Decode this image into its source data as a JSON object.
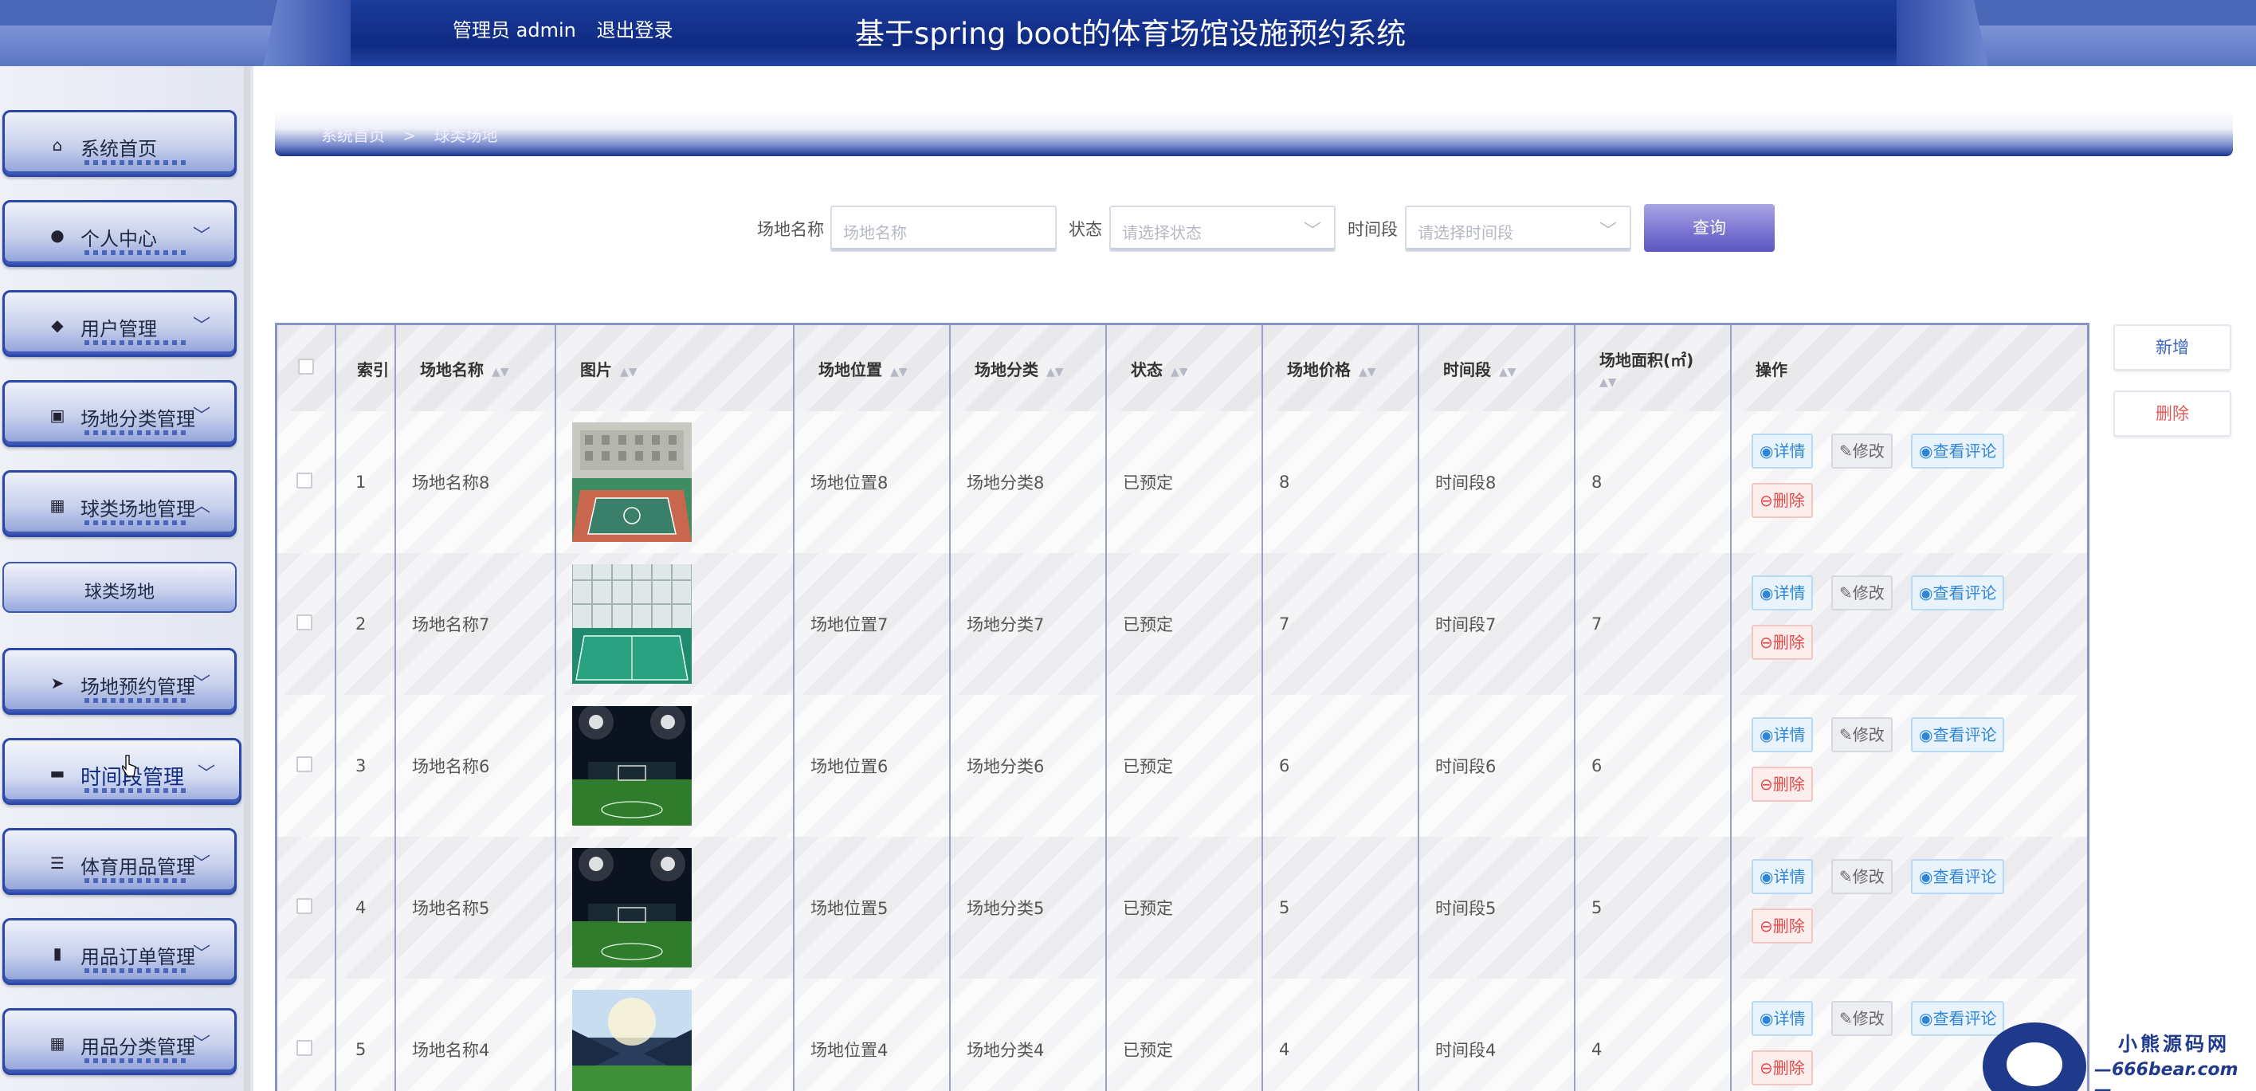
{
  "header": {
    "user_label": "管理员 admin",
    "logout_label": "退出登录",
    "title": "基于spring boot的体育场馆设施预约系统"
  },
  "sidebar": {
    "items": [
      {
        "label": "系统首页",
        "icon": "home-icon",
        "chevron": ""
      },
      {
        "label": "个人中心",
        "icon": "user-icon",
        "chevron": "﹀"
      },
      {
        "label": "用户管理",
        "icon": "users-icon",
        "chevron": "﹀"
      },
      {
        "label": "场地分类管理",
        "icon": "clipboard-icon",
        "chevron": "﹀"
      },
      {
        "label": "球类场地管理",
        "icon": "grid-icon",
        "chevron": "︿"
      },
      {
        "label": "场地预约管理",
        "icon": "send-icon",
        "chevron": "﹀"
      },
      {
        "label": "时间段管理",
        "icon": "briefcase-icon",
        "chevron": "﹀"
      },
      {
        "label": "体育用品管理",
        "icon": "list-icon",
        "chevron": "﹀"
      },
      {
        "label": "用品订单管理",
        "icon": "book-icon",
        "chevron": "﹀"
      },
      {
        "label": "用品分类管理",
        "icon": "grid-icon",
        "chevron": "﹀"
      }
    ],
    "submenu_label": "球类场地"
  },
  "breadcrumb": {
    "home": "系统首页",
    "separator": ">",
    "current": "球类场地"
  },
  "search": {
    "name_label": "场地名称",
    "name_placeholder": "场地名称",
    "status_label": "状态",
    "status_placeholder": "请选择状态",
    "time_label": "时间段",
    "time_placeholder": "请选择时间段",
    "query_button": "查询"
  },
  "actions": {
    "add_label": "新增",
    "delete_label": "删除"
  },
  "table": {
    "headers": {
      "index": "索引",
      "name": "场地名称",
      "image": "图片",
      "location": "场地位置",
      "category": "场地分类",
      "status": "状态",
      "price": "场地价格",
      "timeslot": "时间段",
      "area": "场地面积(㎡)",
      "ops": "操作"
    },
    "ops": {
      "detail": "详情",
      "edit": "修改",
      "review": "查看评论",
      "delete": "删除"
    },
    "rows": [
      {
        "index": "1",
        "name": "场地名称8",
        "location": "场地位置8",
        "category": "场地分类8",
        "status": "已预定",
        "price": "8",
        "timeslot": "时间段8",
        "area": "8",
        "image": "basketball-court"
      },
      {
        "index": "2",
        "name": "场地名称7",
        "location": "场地位置7",
        "category": "场地分类7",
        "status": "已预定",
        "price": "7",
        "timeslot": "时间段7",
        "area": "7",
        "image": "indoor-court"
      },
      {
        "index": "3",
        "name": "场地名称6",
        "location": "场地位置6",
        "category": "场地分类6",
        "status": "已预定",
        "price": "6",
        "timeslot": "时间段6",
        "area": "6",
        "image": "soccer-field"
      },
      {
        "index": "4",
        "name": "场地名称5",
        "location": "场地位置5",
        "category": "场地分类5",
        "status": "已预定",
        "price": "5",
        "timeslot": "时间段5",
        "area": "5",
        "image": "soccer-field"
      },
      {
        "index": "5",
        "name": "场地名称4",
        "location": "场地位置4",
        "category": "场地分类4",
        "status": "已预定",
        "price": "4",
        "timeslot": "时间段4",
        "area": "4",
        "image": "stadium"
      }
    ]
  },
  "watermark": {
    "line1": "小熊源码网",
    "line2": "—666bear.com—"
  },
  "colors": {
    "header_blue": "#0f2a82",
    "accent_purple": "#7c77d3",
    "detail_blue": "#2f86d6",
    "delete_red": "#e04a4a"
  }
}
